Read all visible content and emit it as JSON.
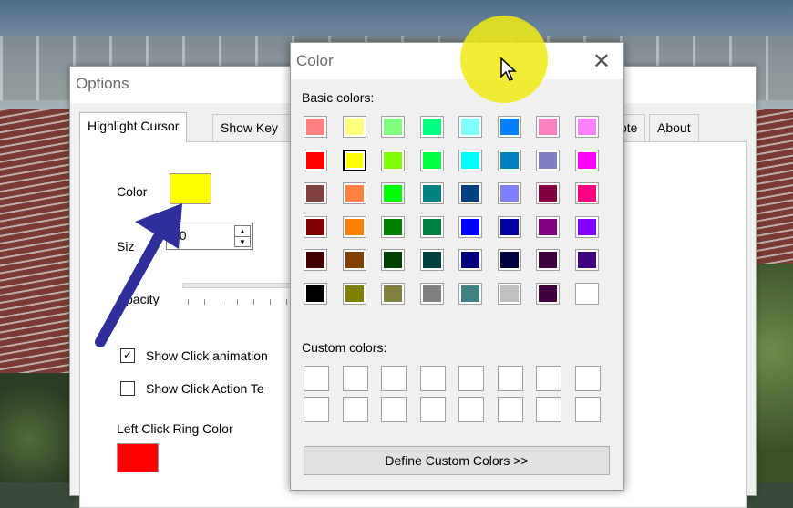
{
  "options": {
    "title": "Options",
    "tabs": [
      "Highlight Cursor",
      "Show Key",
      "ote",
      "About"
    ],
    "color_label": "Color",
    "size_label": "Siz",
    "size_value": "50",
    "opacity_label": "pacity",
    "show_click_animation": "Show Click animation",
    "show_click_animation_checked": true,
    "show_click_action": "Show Click Action Te",
    "show_click_action_checked": false,
    "left_click_ring_color": "Left Click Ring Color",
    "highlight_color": "#ffff00",
    "ring_color": "#ff0000"
  },
  "color_dialog": {
    "title": "Color",
    "close": "✕",
    "basic_colors_label": "Basic colors:",
    "custom_colors_label": "Custom colors:",
    "define_button": "Define Custom Colors >>",
    "basic_colors": [
      [
        "#ff8080",
        "#ffff80",
        "#80ff80",
        "#00ff80",
        "#80ffff",
        "#0080ff",
        "#ff80c0",
        "#ff80ff"
      ],
      [
        "#ff0000",
        "#ffff00",
        "#80ff00",
        "#00ff40",
        "#00ffff",
        "#0080c0",
        "#8080c0",
        "#ff00ff"
      ],
      [
        "#804040",
        "#ff8040",
        "#00ff00",
        "#008080",
        "#004080",
        "#8080ff",
        "#800040",
        "#ff0080"
      ],
      [
        "#800000",
        "#ff8000",
        "#008000",
        "#008040",
        "#0000ff",
        "#0000a0",
        "#800080",
        "#8000ff"
      ],
      [
        "#400000",
        "#804000",
        "#004000",
        "#004040",
        "#000080",
        "#000040",
        "#400040",
        "#400080"
      ],
      [
        "#000000",
        "#808000",
        "#808040",
        "#808080",
        "#408080",
        "#c0c0c0",
        "#400040",
        "#ffffff"
      ]
    ],
    "selected": "#ffff00"
  }
}
